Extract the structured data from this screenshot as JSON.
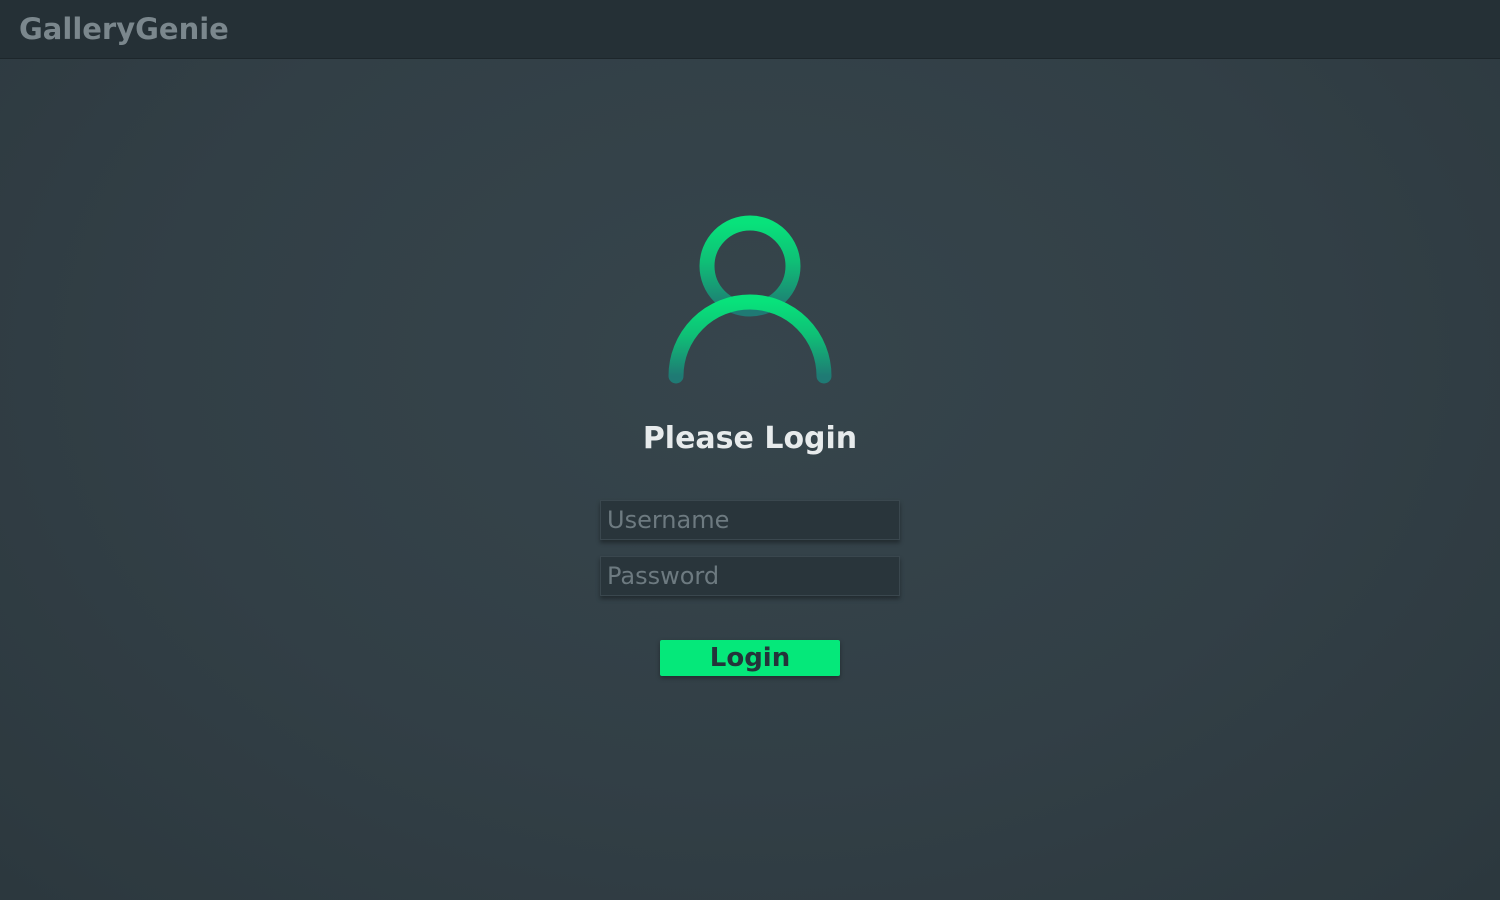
{
  "app": {
    "brand": "GalleryGenie"
  },
  "login": {
    "icon": "user-icon",
    "heading": "Please Login",
    "username": {
      "value": "",
      "placeholder": "Username"
    },
    "password": {
      "value": "",
      "placeholder": "Password"
    },
    "submit_label": "Login"
  },
  "colors": {
    "accent": "#05e87a",
    "icon_gradient_top": "#08e27b",
    "icon_gradient_bottom": "#1f7a74",
    "background": "#323f46",
    "topbar": "#253036"
  }
}
